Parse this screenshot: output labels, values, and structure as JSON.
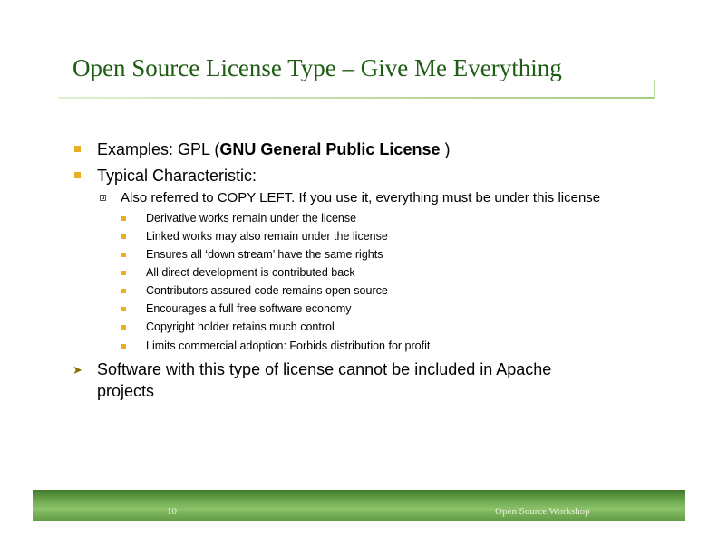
{
  "slide": {
    "title": "Open Source License Type – Give Me Everything"
  },
  "content": {
    "examples": {
      "prefix": "Examples: GPL (",
      "bold": "GNU General Public License",
      "suffix": " )"
    },
    "typical": "Typical Characteristic:",
    "copyleft": "Also referred to COPY LEFT. If you use it, everything must be under this license",
    "sub_items": [
      "Derivative works remain under the license",
      "Linked works may also remain under the license",
      "Ensures all ‘down stream’ have the same rights",
      "All direct development is contributed back",
      "Contributors assured code remains open source",
      "Encourages a full free software economy",
      "Copyright holder retains much control",
      "Limits commercial adoption: Forbids distribution for profit"
    ],
    "conclusion_line1": "Software with this type of license cannot be included in Apache",
    "conclusion_line2": "projects"
  },
  "footer": {
    "page_number": "10",
    "label": "Open Source Workshop"
  },
  "colors": {
    "title": "#1f5c14",
    "bullet": "#e8b020",
    "footer_bar": "#6ea84e"
  },
  "icons": {
    "level1": "filled-square-bullet",
    "level2": "hollow-square-bullet",
    "level3": "small-filled-square-bullet",
    "conclusion": "arrowhead-bullet"
  }
}
